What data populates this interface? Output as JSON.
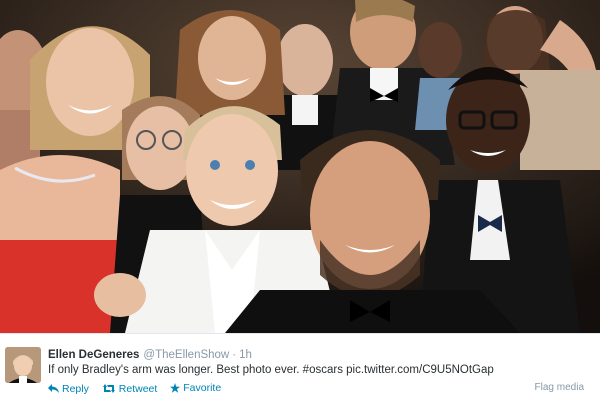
{
  "tweet": {
    "author_name": "Ellen DeGeneres",
    "author_handle": "@TheEllenShow",
    "separator": "·",
    "timestamp": "1h",
    "text": "If only Bradley's arm was longer. Best photo ever. #oscars pic.twitter.com/C9U5NOtGap",
    "actions": {
      "reply": "Reply",
      "retweet": "Retweet",
      "favorite": "Favorite"
    },
    "flag_media": "Flag media"
  },
  "colors": {
    "link": "#0084b4",
    "muted": "#8899a6",
    "text": "#292f33",
    "favorite_star": "#e8a000"
  },
  "icons": {
    "reply": "reply-arrow-icon",
    "retweet": "retweet-arrows-icon",
    "favorite": "star-icon"
  }
}
